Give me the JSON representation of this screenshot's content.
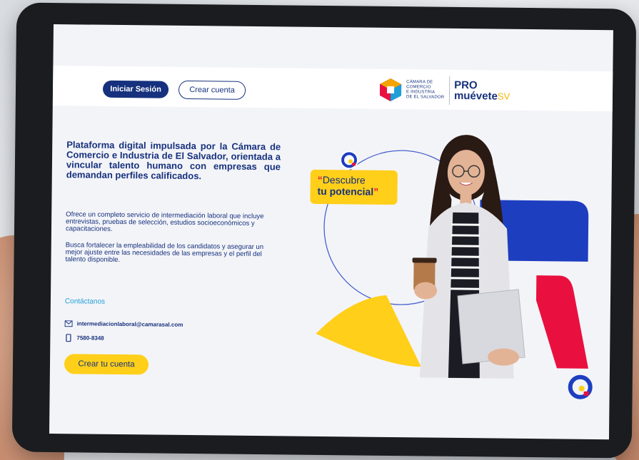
{
  "header": {
    "login_label": "Iniciar Sesión",
    "create_account_label": "Crear cuenta",
    "camara_lines": [
      "CÁMARA DE",
      "COMERCIO",
      "E INDUSTRIA",
      "DE EL SALVADOR"
    ],
    "brand_pro": "PRO",
    "brand_muevete": "muévete",
    "brand_sv": "SV"
  },
  "main": {
    "headline": "Plataforma digital impulsada por la Cámara de Comercio e Industria de El Salvador, orientada a vincular talento humano con empresas que demandan perfiles calificados.",
    "paragraph1": "Ofrece un completo servicio de intermediación laboral que incluye entrevistas, pruebas de selección, estudios socioeconómicos y capacitaciones.",
    "paragraph2": "Busca fortalecer la empleabilidad de los candidatos y asegurar un mejor ajuste entre las necesidades de las empresas y el perfil del talento disponible.",
    "contact_title": "Contáctanos",
    "email": "intermediacionlaboral@camarasal.com",
    "phone": "7580-8348",
    "cta_label": "Crear tu cuenta"
  },
  "hero": {
    "badge_line1": "Descubre",
    "badge_line2": "tu potencial",
    "open_quote": "“",
    "close_quote": "”"
  },
  "icons": {
    "email": "mail-icon",
    "phone": "smartphone-icon",
    "brand": "q-logo-icon"
  },
  "colors": {
    "navy": "#16317d",
    "yellow": "#ffcf1a",
    "blue_accent": "#1e3ec0",
    "pink_accent": "#e9103f",
    "light_blue_text": "#1e9fd8"
  }
}
